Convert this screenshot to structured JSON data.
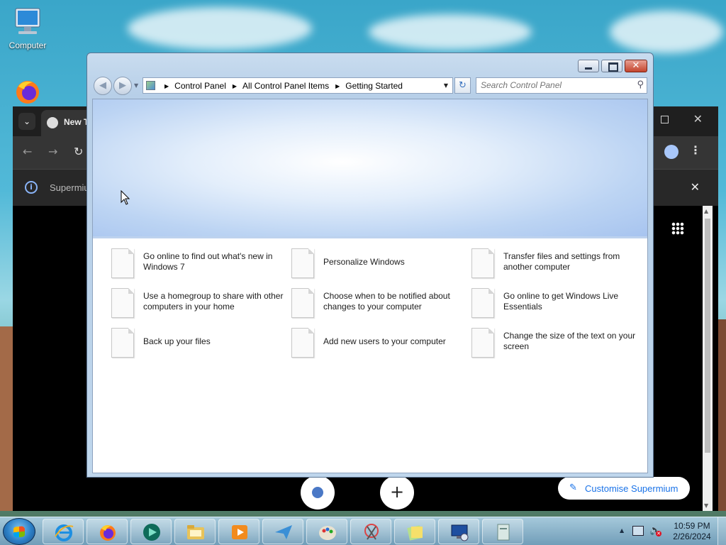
{
  "desktop": {
    "icons": [
      {
        "label": "Computer",
        "icon": "computer-icon"
      },
      {
        "label": "",
        "icon": "firefox-icon"
      }
    ]
  },
  "browser": {
    "tab_title": "New T",
    "info_text": "Supermiu",
    "customise_label": "Customise Supermium",
    "new_shortcut_symbol": "+",
    "accent": "#1a73e8"
  },
  "control_panel": {
    "address": {
      "crumbs": [
        "Control Panel",
        "All Control Panel Items",
        "Getting Started"
      ]
    },
    "search_placeholder": "Search Control Panel",
    "tasks": [
      {
        "label": "Go online to find out what's new in Windows 7"
      },
      {
        "label": "Personalize Windows"
      },
      {
        "label": "Transfer files and settings from another computer"
      },
      {
        "label": "Use a homegroup to share with other computers in your home"
      },
      {
        "label": "Choose when to be notified about changes to your computer"
      },
      {
        "label": "Go online to get Windows Live Essentials"
      },
      {
        "label": "Back up your files"
      },
      {
        "label": "Add new users to your computer"
      },
      {
        "label": "Change the size of the text on your screen"
      }
    ]
  },
  "taskbar": {
    "pinned": [
      "internet-explorer-icon",
      "firefox-icon",
      "media-app-icon",
      "file-explorer-icon",
      "media-player-icon",
      "send-icon",
      "paint-icon",
      "snipping-tool-icon",
      "sticky-notes-icon",
      "remote-desktop-icon",
      "document-icon"
    ],
    "clock": {
      "time": "10:59 PM",
      "date": "2/26/2024"
    }
  }
}
